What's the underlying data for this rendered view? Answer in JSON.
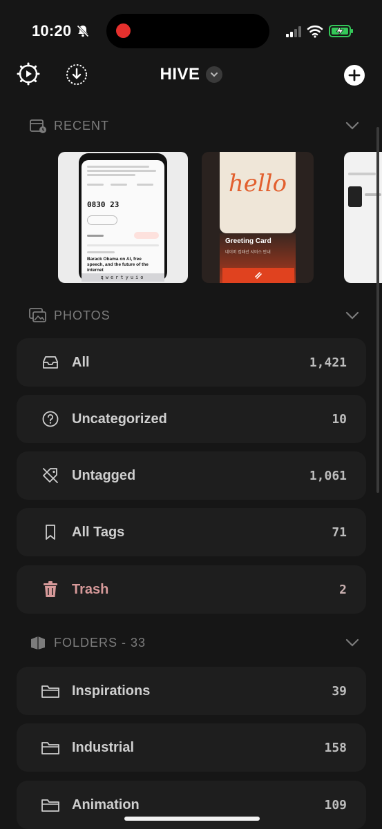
{
  "status_bar": {
    "time": "10:20"
  },
  "header": {
    "title": "HIVE"
  },
  "recent": {
    "label": "RECENT",
    "cards": [
      {
        "name": "article-screenshot",
        "code": "0830 23",
        "headline": "Barack Obama on AI, free speech, and the future of the internet",
        "keyboard": "qwertyuio"
      },
      {
        "name": "greeting-card",
        "hello": "hello",
        "title": "Greeting Card",
        "subtitle": "네이버 컴패션 서비스 안내"
      },
      {
        "name": "partial-card"
      }
    ]
  },
  "photos": {
    "label": "PHOTOS",
    "items": [
      {
        "label": "All",
        "count": "1,421",
        "icon": "inbox-icon"
      },
      {
        "label": "Uncategorized",
        "count": "10",
        "icon": "question-circle-icon"
      },
      {
        "label": "Untagged",
        "count": "1,061",
        "icon": "tag-off-icon"
      },
      {
        "label": "All Tags",
        "count": "71",
        "icon": "bookmark-icon"
      },
      {
        "label": "Trash",
        "count": "2",
        "icon": "trash-icon",
        "color": "#d79a9a"
      }
    ]
  },
  "folders": {
    "label": "FOLDERS - 33",
    "items": [
      {
        "label": "Inspirations",
        "count": "39",
        "icon": "folder-icon"
      },
      {
        "label": "Industrial",
        "count": "158",
        "icon": "folder-icon"
      },
      {
        "label": "Animation",
        "count": "109",
        "icon": "folder-icon"
      }
    ]
  },
  "colors": {
    "background": "#161616",
    "row": "#1e1e1e",
    "record": "#e5302d",
    "battery": "#34c759"
  }
}
